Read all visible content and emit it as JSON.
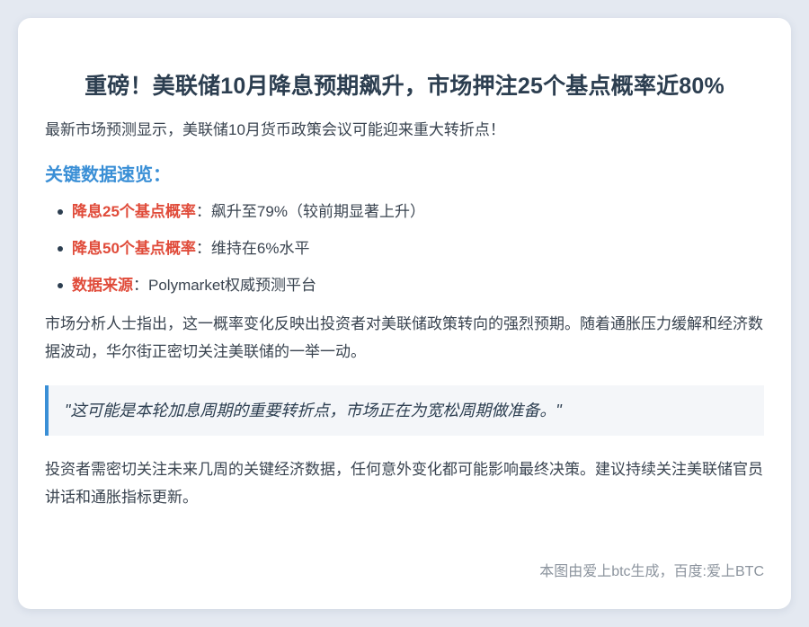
{
  "article": {
    "title": "重磅！美联储10月降息预期飙升，市场押注25个基点概率近80%",
    "intro": "最新市场预测显示，美联储10月货币政策会议可能迎来重大转折点！",
    "section_heading": "关键数据速览：",
    "key_points": [
      {
        "label": "降息25个基点概率",
        "text": "：飙升至79%（较前期显著上升）"
      },
      {
        "label": "降息50个基点概率",
        "text": "：维持在6%水平"
      },
      {
        "label": "数据来源",
        "text": "：Polymarket权威预测平台"
      }
    ],
    "paragraph_1": "市场分析人士指出，这一概率变化反映出投资者对美联储政策转向的强烈预期。随着通胀压力缓解和经济数据波动，华尔街正密切关注美联储的一举一动。",
    "quote": "\"这可能是本轮加息周期的重要转折点，市场正在为宽松周期做准备。\"",
    "paragraph_2": "投资者需密切关注未来几周的关键经济数据，任何意外变化都可能影响最终决策。建议持续关注美联储官员讲话和通胀指标更新。",
    "footer": "本图由爱上btc生成，百度:爱上BTC"
  },
  "colors": {
    "background": "#e4e9f1",
    "card": "#ffffff",
    "title": "#2c3e50",
    "accent_blue": "#3a8fd6",
    "accent_red": "#e04b3a",
    "body_text": "#3a4450",
    "footer_text": "#8c949e",
    "quote_bg": "#f4f6f9"
  }
}
